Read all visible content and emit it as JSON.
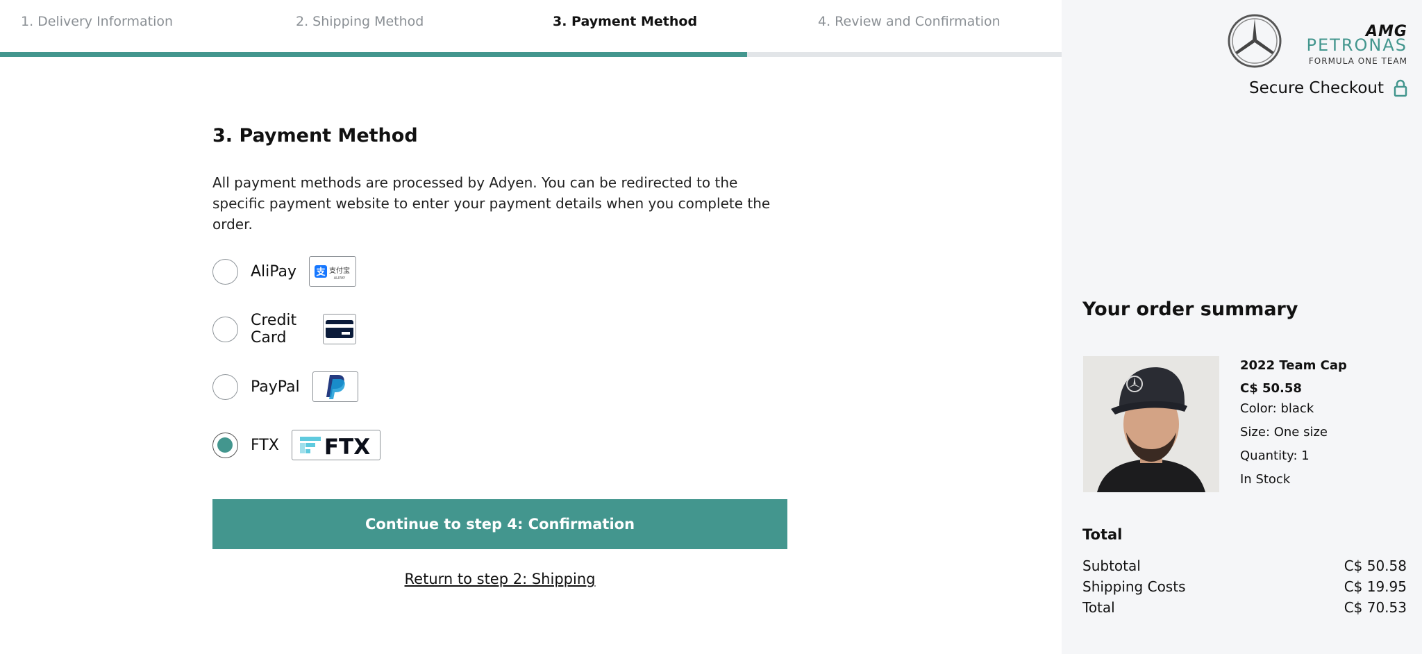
{
  "steps": [
    {
      "label": "1. Delivery Information"
    },
    {
      "label": "2. Shipping Method"
    },
    {
      "label": "3. Payment Method"
    },
    {
      "label": "4. Review and Confirmation"
    }
  ],
  "progress": {
    "current_step": 3,
    "total_steps": 4,
    "fill_fraction": 0.704
  },
  "main": {
    "title": "3. Payment Method",
    "description": "All payment methods are processed by Adyen. You can be redirected to the specific payment website to enter your payment details when you complete the order.",
    "methods": [
      {
        "label": "AliPay",
        "icon": "alipay-logo-icon",
        "selected": false,
        "logo_text": "支付宝",
        "logo_subtext": "ALIPAY"
      },
      {
        "label": "Credit Card",
        "icon": "credit-card-icon",
        "selected": false
      },
      {
        "label": "PayPal",
        "icon": "paypal-logo-icon",
        "selected": false
      },
      {
        "label": "FTX",
        "icon": "ftx-logo-icon",
        "selected": true,
        "logo_text": "FTX"
      }
    ],
    "continue_label": "Continue to step 4: Confirmation",
    "back_label": "Return to step 2: Shipping"
  },
  "sidebar": {
    "brand": {
      "line1": "AMG",
      "line2": "PETRONAS",
      "line3": "FORMULA ONE TEAM"
    },
    "secure_label": "Secure Checkout",
    "summary_title": "Your order summary",
    "product": {
      "name": "2022 Team Cap",
      "price": "C$ 50.58",
      "color": "Color: black",
      "size": "Size: One size",
      "quantity": "Quantity: 1",
      "stock": "In Stock"
    },
    "total_heading": "Total",
    "totals": [
      {
        "label": "Subtotal",
        "value": "C$ 50.58"
      },
      {
        "label": "Shipping Costs",
        "value": "C$ 19.95"
      },
      {
        "label": "Total",
        "value": "C$ 70.53"
      }
    ]
  },
  "colors": {
    "accent": "#43968e",
    "sidebar_bg": "#f5f6f8",
    "track": "#e2e5e8"
  }
}
